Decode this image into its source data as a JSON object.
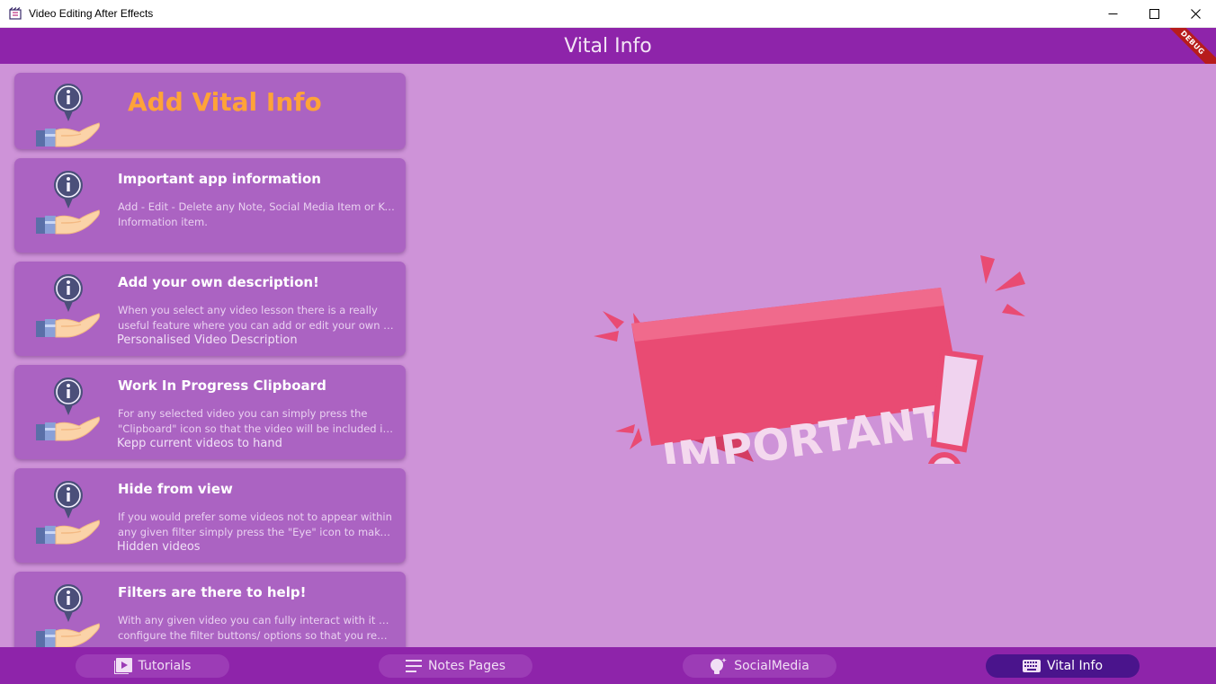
{
  "window": {
    "title": "Video Editing After Effects",
    "controls": [
      "minimize-icon",
      "maximize-icon",
      "close-icon"
    ]
  },
  "appbar": {
    "title": "Vital Info",
    "debug_label": "DEBUG"
  },
  "header_card": {
    "title": "Add Vital Info",
    "icon": "info-hand-icon"
  },
  "cards": [
    {
      "title": "Important app information",
      "desc_lines": [
        "Add - Edit - Delete any Note, Social Media Item or Key",
        "Information item."
      ],
      "subtitle": ""
    },
    {
      "title": "Add your own description!",
      "desc_lines": [
        "When you select any video lesson there is a really",
        "useful feature where you can add or edit your own Vi..."
      ],
      "subtitle": "Personalised Video Description"
    },
    {
      "title": "Work In Progress Clipboard",
      "desc_lines": [
        "For any selected video you can simply press the",
        "\"Clipboard\" icon so that the video will be included in ..."
      ],
      "subtitle": "Kepp current videos to hand"
    },
    {
      "title": "Hide from view",
      "desc_lines": [
        "If you would prefer some videos not to appear within",
        "any given filter simply press the \"Eye\" icon to make t..."
      ],
      "subtitle": "Hidden videos"
    },
    {
      "title": "Filters are there to help!",
      "desc_lines": [
        "With any given video you can fully interact with it and",
        "configure the filter buttons/ options so that you rem..."
      ],
      "subtitle": ""
    }
  ],
  "illustration": {
    "text": "IMPORTANT"
  },
  "bottom_nav": [
    {
      "label": "Tutorials",
      "icon": "video-library-icon",
      "active": false
    },
    {
      "label": "Notes Pages",
      "icon": "notes-icon",
      "active": false
    },
    {
      "label": "SocialMedia",
      "icon": "lightbulb-icon",
      "active": false
    },
    {
      "label": "Vital Info",
      "icon": "keyboard-icon",
      "active": true
    }
  ],
  "colors": {
    "appbar": "#8e24aa",
    "background": "#ce93d8",
    "card": "#ab63c2",
    "header_title": "#ffa338",
    "nav_active": "#4a148c",
    "banner": "#e94b73"
  }
}
